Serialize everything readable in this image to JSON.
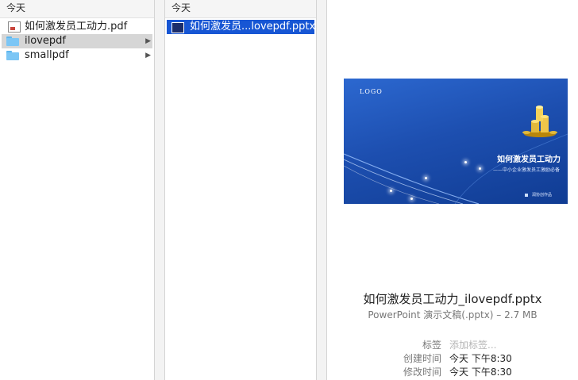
{
  "column1": {
    "header": "今天",
    "items": [
      {
        "label": "如何激发员工动力.pdf"
      },
      {
        "label": "ilovepdf"
      },
      {
        "label": "smallpdf"
      }
    ]
  },
  "column2": {
    "header": "今天",
    "items": [
      {
        "label": "如何激发员...lovepdf.pptx"
      }
    ]
  },
  "preview": {
    "slide": {
      "logo": "LOGO",
      "title": "如何激发员工动力",
      "subtitle": "——中小企业激发员工激励必备",
      "footer": "润协创作品"
    },
    "file_name": "如何激发员工动力_ilovepdf.pptx",
    "file_kind": "PowerPoint 演示文稿(.pptx) – 2.7 MB",
    "tags_label": "标签",
    "tags_placeholder": "添加标签...",
    "created_label": "创建时间",
    "created_value": "今天 下午8:30",
    "modified_label": "修改时间",
    "modified_value": "今天 下午8:30"
  },
  "colors": {
    "selection": "#1756d4",
    "folder": "#7cc6f5",
    "highlight": "#d6d6d6"
  }
}
